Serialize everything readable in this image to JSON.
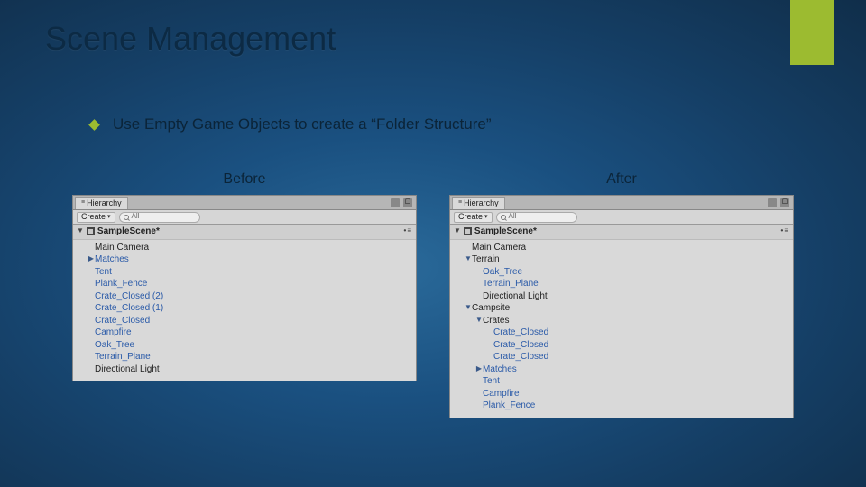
{
  "title": "Scene Management",
  "bullet_text": "Use Empty Game Objects to create a “Folder Structure”",
  "labels": {
    "before": "Before",
    "after": "After"
  },
  "hierarchy": {
    "tab_label": "Hierarchy",
    "create_label": "Create",
    "search_placeholder": "All",
    "scene_name": "SampleScene*"
  },
  "before_tree": [
    {
      "label": "Main Camera",
      "indent": 1,
      "arrow": "none",
      "color": "black"
    },
    {
      "label": "Matches",
      "indent": 1,
      "arrow": "right",
      "color": "blue"
    },
    {
      "label": "Tent",
      "indent": 1,
      "arrow": "none",
      "color": "blue"
    },
    {
      "label": "Plank_Fence",
      "indent": 1,
      "arrow": "none",
      "color": "blue"
    },
    {
      "label": "Crate_Closed (2)",
      "indent": 1,
      "arrow": "none",
      "color": "blue"
    },
    {
      "label": "Crate_Closed (1)",
      "indent": 1,
      "arrow": "none",
      "color": "blue"
    },
    {
      "label": "Crate_Closed",
      "indent": 1,
      "arrow": "none",
      "color": "blue"
    },
    {
      "label": "Campfire",
      "indent": 1,
      "arrow": "none",
      "color": "blue"
    },
    {
      "label": "Oak_Tree",
      "indent": 1,
      "arrow": "none",
      "color": "blue"
    },
    {
      "label": "Terrain_Plane",
      "indent": 1,
      "arrow": "none",
      "color": "blue"
    },
    {
      "label": "Directional Light",
      "indent": 1,
      "arrow": "none",
      "color": "black"
    }
  ],
  "after_tree": [
    {
      "label": "Main Camera",
      "indent": 1,
      "arrow": "none",
      "color": "black"
    },
    {
      "label": "Terrain",
      "indent": 1,
      "arrow": "down",
      "color": "black"
    },
    {
      "label": "Oak_Tree",
      "indent": 2,
      "arrow": "none",
      "color": "blue"
    },
    {
      "label": "Terrain_Plane",
      "indent": 2,
      "arrow": "none",
      "color": "blue"
    },
    {
      "label": "Directional Light",
      "indent": 2,
      "arrow": "none",
      "color": "black"
    },
    {
      "label": "Campsite",
      "indent": 1,
      "arrow": "down",
      "color": "black"
    },
    {
      "label": "Crates",
      "indent": 2,
      "arrow": "down",
      "color": "black"
    },
    {
      "label": "Crate_Closed",
      "indent": 3,
      "arrow": "none",
      "color": "blue"
    },
    {
      "label": "Crate_Closed",
      "indent": 3,
      "arrow": "none",
      "color": "blue"
    },
    {
      "label": "Crate_Closed",
      "indent": 3,
      "arrow": "none",
      "color": "blue"
    },
    {
      "label": "Matches",
      "indent": 2,
      "arrow": "right",
      "color": "blue"
    },
    {
      "label": "Tent",
      "indent": 2,
      "arrow": "none",
      "color": "blue"
    },
    {
      "label": "Campfire",
      "indent": 2,
      "arrow": "none",
      "color": "blue"
    },
    {
      "label": "Plank_Fence",
      "indent": 2,
      "arrow": "none",
      "color": "blue"
    }
  ]
}
